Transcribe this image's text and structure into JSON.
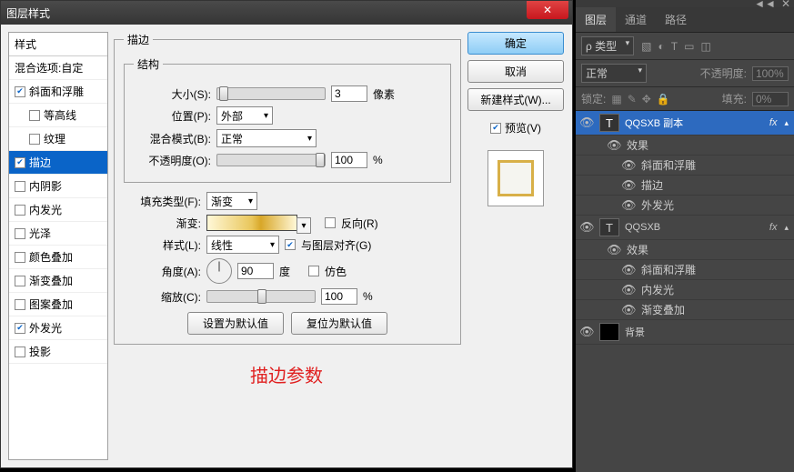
{
  "dialog": {
    "title": "图层样式",
    "styles": {
      "header": "样式",
      "blending": "混合选项:自定",
      "items": [
        {
          "label": "斜面和浮雕",
          "checked": true
        },
        {
          "label": "等高线",
          "checked": false,
          "indent": true
        },
        {
          "label": "纹理",
          "checked": false,
          "indent": true
        },
        {
          "label": "描边",
          "checked": true,
          "selected": true
        },
        {
          "label": "内阴影",
          "checked": false
        },
        {
          "label": "内发光",
          "checked": false
        },
        {
          "label": "光泽",
          "checked": false
        },
        {
          "label": "颜色叠加",
          "checked": false
        },
        {
          "label": "渐变叠加",
          "checked": false
        },
        {
          "label": "图案叠加",
          "checked": false
        },
        {
          "label": "外发光",
          "checked": true
        },
        {
          "label": "投影",
          "checked": false
        }
      ]
    },
    "stroke": {
      "legend": "描边",
      "structure_legend": "结构",
      "size_label": "大小(S):",
      "size_value": "3",
      "size_unit": "像素",
      "position_label": "位置(P):",
      "position_value": "外部",
      "blend_label": "混合模式(B):",
      "blend_value": "正常",
      "opacity_label": "不透明度(O):",
      "opacity_value": "100",
      "opacity_unit": "%",
      "filltype_label": "填充类型(F):",
      "filltype_value": "渐变",
      "gradient_label": "渐变:",
      "reverse_label": "反向(R)",
      "reverse_checked": false,
      "style_label": "样式(L):",
      "style_value": "线性",
      "align_label": "与图层对齐(G)",
      "align_checked": true,
      "angle_label": "角度(A):",
      "angle_value": "90",
      "angle_unit": "度",
      "dither_label": "仿色",
      "dither_checked": false,
      "scale_label": "缩放(C):",
      "scale_value": "100",
      "scale_unit": "%",
      "reset_default": "设置为默认值",
      "restore_default": "复位为默认值"
    },
    "buttons": {
      "ok": "确定",
      "cancel": "取消",
      "new_style": "新建样式(W)...",
      "preview": "预览(V)"
    },
    "annotation": "描边参数"
  },
  "ps": {
    "tabs": [
      "图层",
      "通道",
      "路径"
    ],
    "kind_label": "ρ 类型",
    "blend_mode": "正常",
    "opacity_label": "不透明度:",
    "opacity_value": "100%",
    "lock_label": "锁定:",
    "fill_label": "填充:",
    "fill_value": "0%",
    "layers": [
      {
        "name": "QQSXB 副本",
        "type": "T",
        "selected": true,
        "fx": true,
        "effects": [
          "效果",
          "斜面和浮雕",
          "描边",
          "外发光"
        ]
      },
      {
        "name": "QQSXB",
        "type": "T",
        "fx": true,
        "effects": [
          "效果",
          "斜面和浮雕",
          "内发光",
          "渐变叠加"
        ]
      },
      {
        "name": "背景",
        "type": "bg"
      }
    ]
  }
}
